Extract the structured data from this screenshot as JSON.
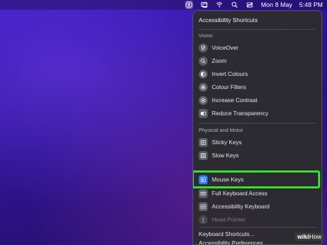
{
  "menubar": {
    "date": "Mon 8 May",
    "time": "5:48 PM",
    "icons": [
      "accessibility-icon",
      "screen-mirroring-icon",
      "wifi-icon",
      "search-icon",
      "control-center-icon"
    ]
  },
  "menu": {
    "title": "Accessibility Shortcuts",
    "vision_header": "Vision",
    "vision_items": [
      {
        "label": "VoiceOver",
        "icon": "voiceover-icon"
      },
      {
        "label": "Zoom",
        "icon": "zoom-icon"
      },
      {
        "label": "Invert Colours",
        "icon": "invert-colours-icon"
      },
      {
        "label": "Colour Filters",
        "icon": "colour-filters-icon"
      },
      {
        "label": "Increase Contrast",
        "icon": "contrast-icon"
      },
      {
        "label": "Reduce Transparency",
        "icon": "transparency-icon"
      }
    ],
    "motor_header": "Physical and Motor",
    "motor_items": [
      {
        "label": "Sticky Keys",
        "icon": "sticky-keys-icon"
      },
      {
        "label": "Slow Keys",
        "icon": "slow-keys-icon"
      },
      {
        "label": "Mouse Keys",
        "icon": "mouse-keys-icon",
        "selected": true
      },
      {
        "label": "Full Keyboard Access",
        "icon": "keyboard-icon"
      },
      {
        "label": "Accessibility Keyboard",
        "icon": "accessibility-keyboard-icon"
      },
      {
        "label": "Head Pointer",
        "icon": "head-pointer-icon",
        "disabled": true
      }
    ],
    "links": [
      "Keyboard Shortcuts...",
      "Accessibility Preferences..."
    ]
  },
  "highlight_color": "#39e32b",
  "watermark": {
    "wiki": "wiki",
    "how": "How"
  }
}
